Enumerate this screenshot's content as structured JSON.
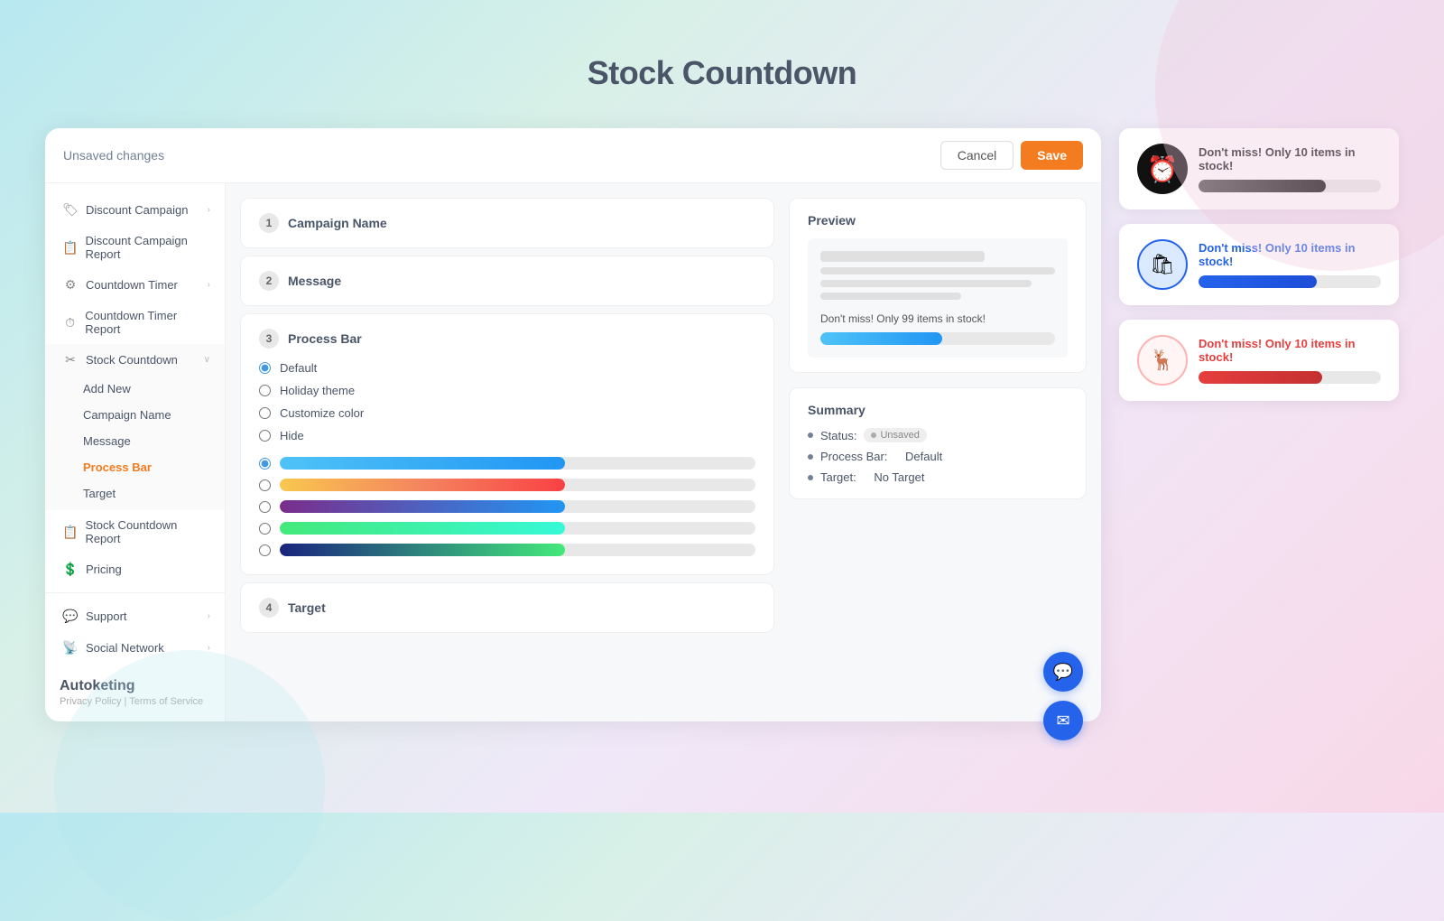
{
  "page": {
    "title": "Stock Countdown"
  },
  "topbar": {
    "unsaved_label": "Unsaved changes",
    "cancel_label": "Cancel",
    "save_label": "Save"
  },
  "sidebar": {
    "items": [
      {
        "id": "discount-campaign",
        "label": "Discount Campaign",
        "icon": "🏷",
        "has_arrow": true
      },
      {
        "id": "discount-campaign-report",
        "label": "Discount Campaign Report",
        "icon": "📋",
        "has_arrow": false
      },
      {
        "id": "countdown-timer",
        "label": "Countdown Timer",
        "icon": "⚙",
        "has_arrow": true
      },
      {
        "id": "countdown-timer-report",
        "label": "Countdown Timer Report",
        "icon": "⏱",
        "has_arrow": false
      },
      {
        "id": "stock-countdown",
        "label": "Stock Countdown",
        "icon": "✂",
        "has_arrow": false,
        "active": true
      }
    ],
    "stock_countdown_sub": [
      {
        "id": "add-new",
        "label": "Add New"
      },
      {
        "id": "campaign-name",
        "label": "Campaign Name"
      },
      {
        "id": "message",
        "label": "Message"
      },
      {
        "id": "process-bar",
        "label": "Process Bar",
        "active": true
      },
      {
        "id": "target",
        "label": "Target"
      }
    ],
    "items2": [
      {
        "id": "stock-countdown-report",
        "label": "Stock Countdown Report",
        "icon": "📋"
      },
      {
        "id": "pricing",
        "label": "Pricing",
        "icon": "💲"
      }
    ],
    "items3": [
      {
        "id": "support",
        "label": "Support",
        "icon": "💬",
        "has_arrow": true
      },
      {
        "id": "social-network",
        "label": "Social Network",
        "icon": "📡",
        "has_arrow": true
      }
    ],
    "logo": "Autoketing",
    "privacy": "Privacy Policy",
    "terms": "Terms of Service",
    "separator": "|"
  },
  "sections": [
    {
      "number": "1",
      "title": "Campaign Name"
    },
    {
      "number": "2",
      "title": "Message"
    },
    {
      "number": "3",
      "title": "Process Bar"
    },
    {
      "number": "4",
      "title": "Target"
    }
  ],
  "process_bar": {
    "options": [
      {
        "id": "default",
        "label": "Default",
        "selected": true
      },
      {
        "id": "holiday",
        "label": "Holiday theme",
        "selected": false
      },
      {
        "id": "custom",
        "label": "Customize color",
        "selected": false
      },
      {
        "id": "hide",
        "label": "Hide",
        "selected": false
      }
    ],
    "bars": [
      {
        "id": "bar1",
        "selected": true,
        "color": "#2196f3",
        "gradient": "linear-gradient(90deg, #4fc3f7, #2196f3)"
      },
      {
        "id": "bar2",
        "selected": false,
        "gradient": "linear-gradient(90deg, #f9c74f, #f4845f, #f94144)"
      },
      {
        "id": "bar3",
        "selected": false,
        "gradient": "linear-gradient(90deg, #7b2d8b, #2196f3)"
      },
      {
        "id": "bar4",
        "selected": false,
        "gradient": "linear-gradient(90deg, #43e97b, #38f9d7)"
      },
      {
        "id": "bar5",
        "selected": false,
        "gradient": "linear-gradient(90deg, #1a237e, #43e97b)"
      }
    ]
  },
  "preview": {
    "title": "Preview",
    "stock_text": "Don't miss! Only 99 items in stock!"
  },
  "summary": {
    "title": "Summary",
    "status_label": "Status:",
    "status_value": "Unsaved",
    "process_bar_label": "Process Bar:",
    "process_bar_value": "Default",
    "target_label": "Target:",
    "target_value": "No Target"
  },
  "widgets": [
    {
      "id": "widget-black",
      "text": "Don't miss! Only 10 items in stock!",
      "text_color": "#222",
      "bar_gradient": "linear-gradient(90deg, #555, #111)",
      "bar_width": "70%",
      "icon_emoji": "🕐",
      "icon_bg": "#111"
    },
    {
      "id": "widget-blue",
      "text": "Don't miss! Only 10 items in stock!",
      "text_color": "#2563eb",
      "bar_gradient": "linear-gradient(90deg, #2563eb, #1d4ed8)",
      "bar_width": "65%",
      "icon_emoji": "🛍",
      "icon_bg": "#dbeafe"
    },
    {
      "id": "widget-red",
      "text": "Don't miss! Only 10 items in stock!",
      "text_color": "#e53e3e",
      "bar_gradient": "linear-gradient(90deg, #e53e3e, #c53030)",
      "bar_width": "68%",
      "icon_emoji": "🦌",
      "icon_bg": "#fff5f5"
    }
  ],
  "float_buttons": [
    {
      "id": "chat-btn",
      "icon": "💬"
    },
    {
      "id": "messenger-btn",
      "icon": "✈"
    }
  ]
}
